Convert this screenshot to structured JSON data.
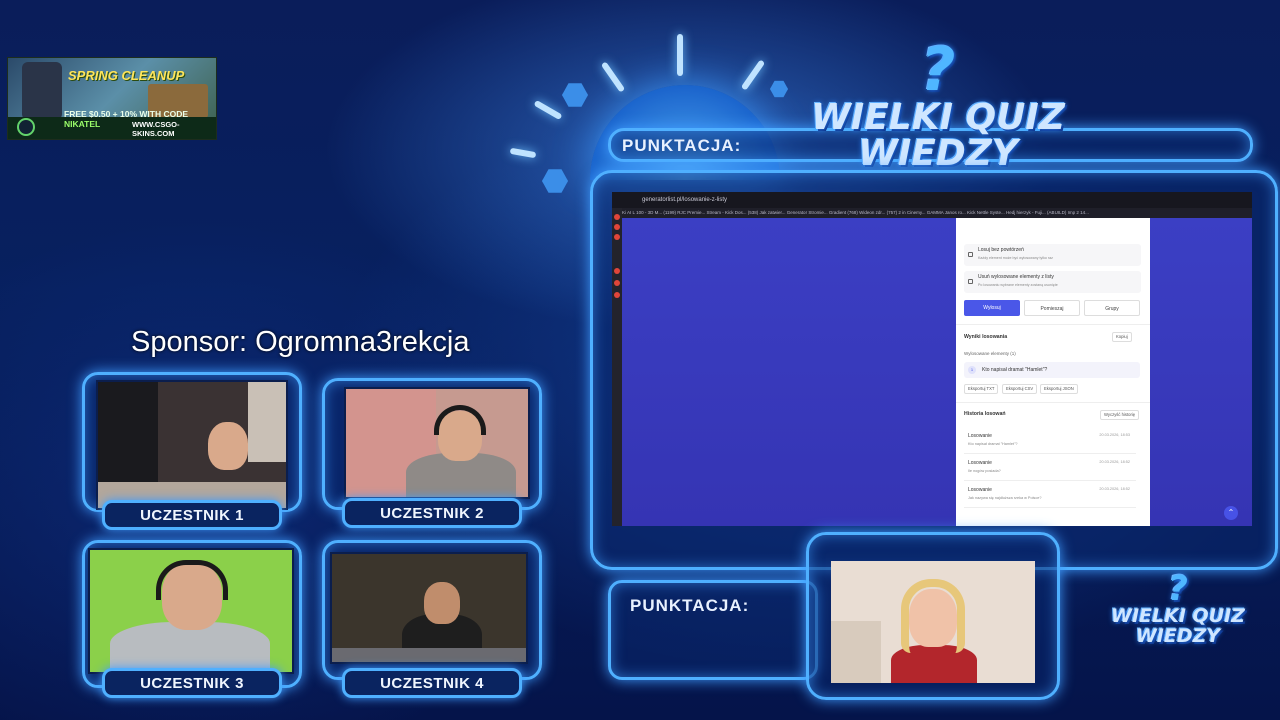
{
  "ad": {
    "title": "SPRING CLEANUP",
    "promo_prefix": "FREE $0.50 + 10% WITH CODE",
    "promo_code": "NIKATEL",
    "url": "WWW.CSGO-SKINS.COM"
  },
  "sponsor": "Sponsor: Ogromna3rekcja",
  "score_label_top": "PUNKTACJA:",
  "score_label_bottom": "PUNKTACJA:",
  "logo": {
    "line1": "WIELKI QUIZ",
    "line2": "WIEDZY",
    "symbol": "?"
  },
  "participants": [
    {
      "label": "UCZESTNIK 1"
    },
    {
      "label": "UCZESTNIK 2"
    },
    {
      "label": "UCZESTNIK 3"
    },
    {
      "label": "UCZESTNIK 4"
    }
  ],
  "browser": {
    "address": "generatorlist.pl/losowanie-z-listy",
    "bookmarks": "Ki AI L 100 - 3D M...   (1199) RJC Premie...   Stream - Kick Dos...   (538) Jak zatwier...   Generator Stromie...   Gradient   (768) Wideon zdr...   (757) 2 in Cinemy...   GAMMA Janos ro...   Kick Nettle Syste...   Hedj hierzyk - Fuji...   (ABUILD) Imp 2 14..."
  },
  "card": {
    "option1_title": "Losuj bez powtórzeń",
    "option1_sub": "Każdy element może być wylosowany tylko raz",
    "option2_title": "Usuń wylosowane elementy z listy",
    "option2_sub": "Po losowaniu wybrane elementy zostaną usunięte",
    "btn_draw": "Wylosuj",
    "btn_shuffle": "Pomieszaj",
    "btn_groups": "Grupy",
    "results_title": "Wyniki losowania",
    "copy_btn": "Kopiuj",
    "drawn_label": "Wylosowane elementy (1)",
    "drawn_index": "1",
    "drawn_item": "Kto napisał dramat \"Hamlet\"?",
    "export_txt": "Eksportuj TXT",
    "export_csv": "Eksportuj CSV",
    "export_json": "Eksportuj JSON",
    "history_title": "Historia losowań",
    "clear_history": "Wyczyść historię",
    "history": [
      {
        "title": "Losowanie",
        "sub": "Kto napisał dramat \"Hamlet\"?",
        "date": "20.03.2026, 18:53"
      },
      {
        "title": "Losowanie",
        "sub": "Ile nogów posiada?",
        "date": "20.03.2026, 18:52"
      },
      {
        "title": "Losowanie",
        "sub": "Jak nazywa się najdłuższa rzeka w Polsce?",
        "date": "20.03.2026, 18:52"
      }
    ]
  }
}
